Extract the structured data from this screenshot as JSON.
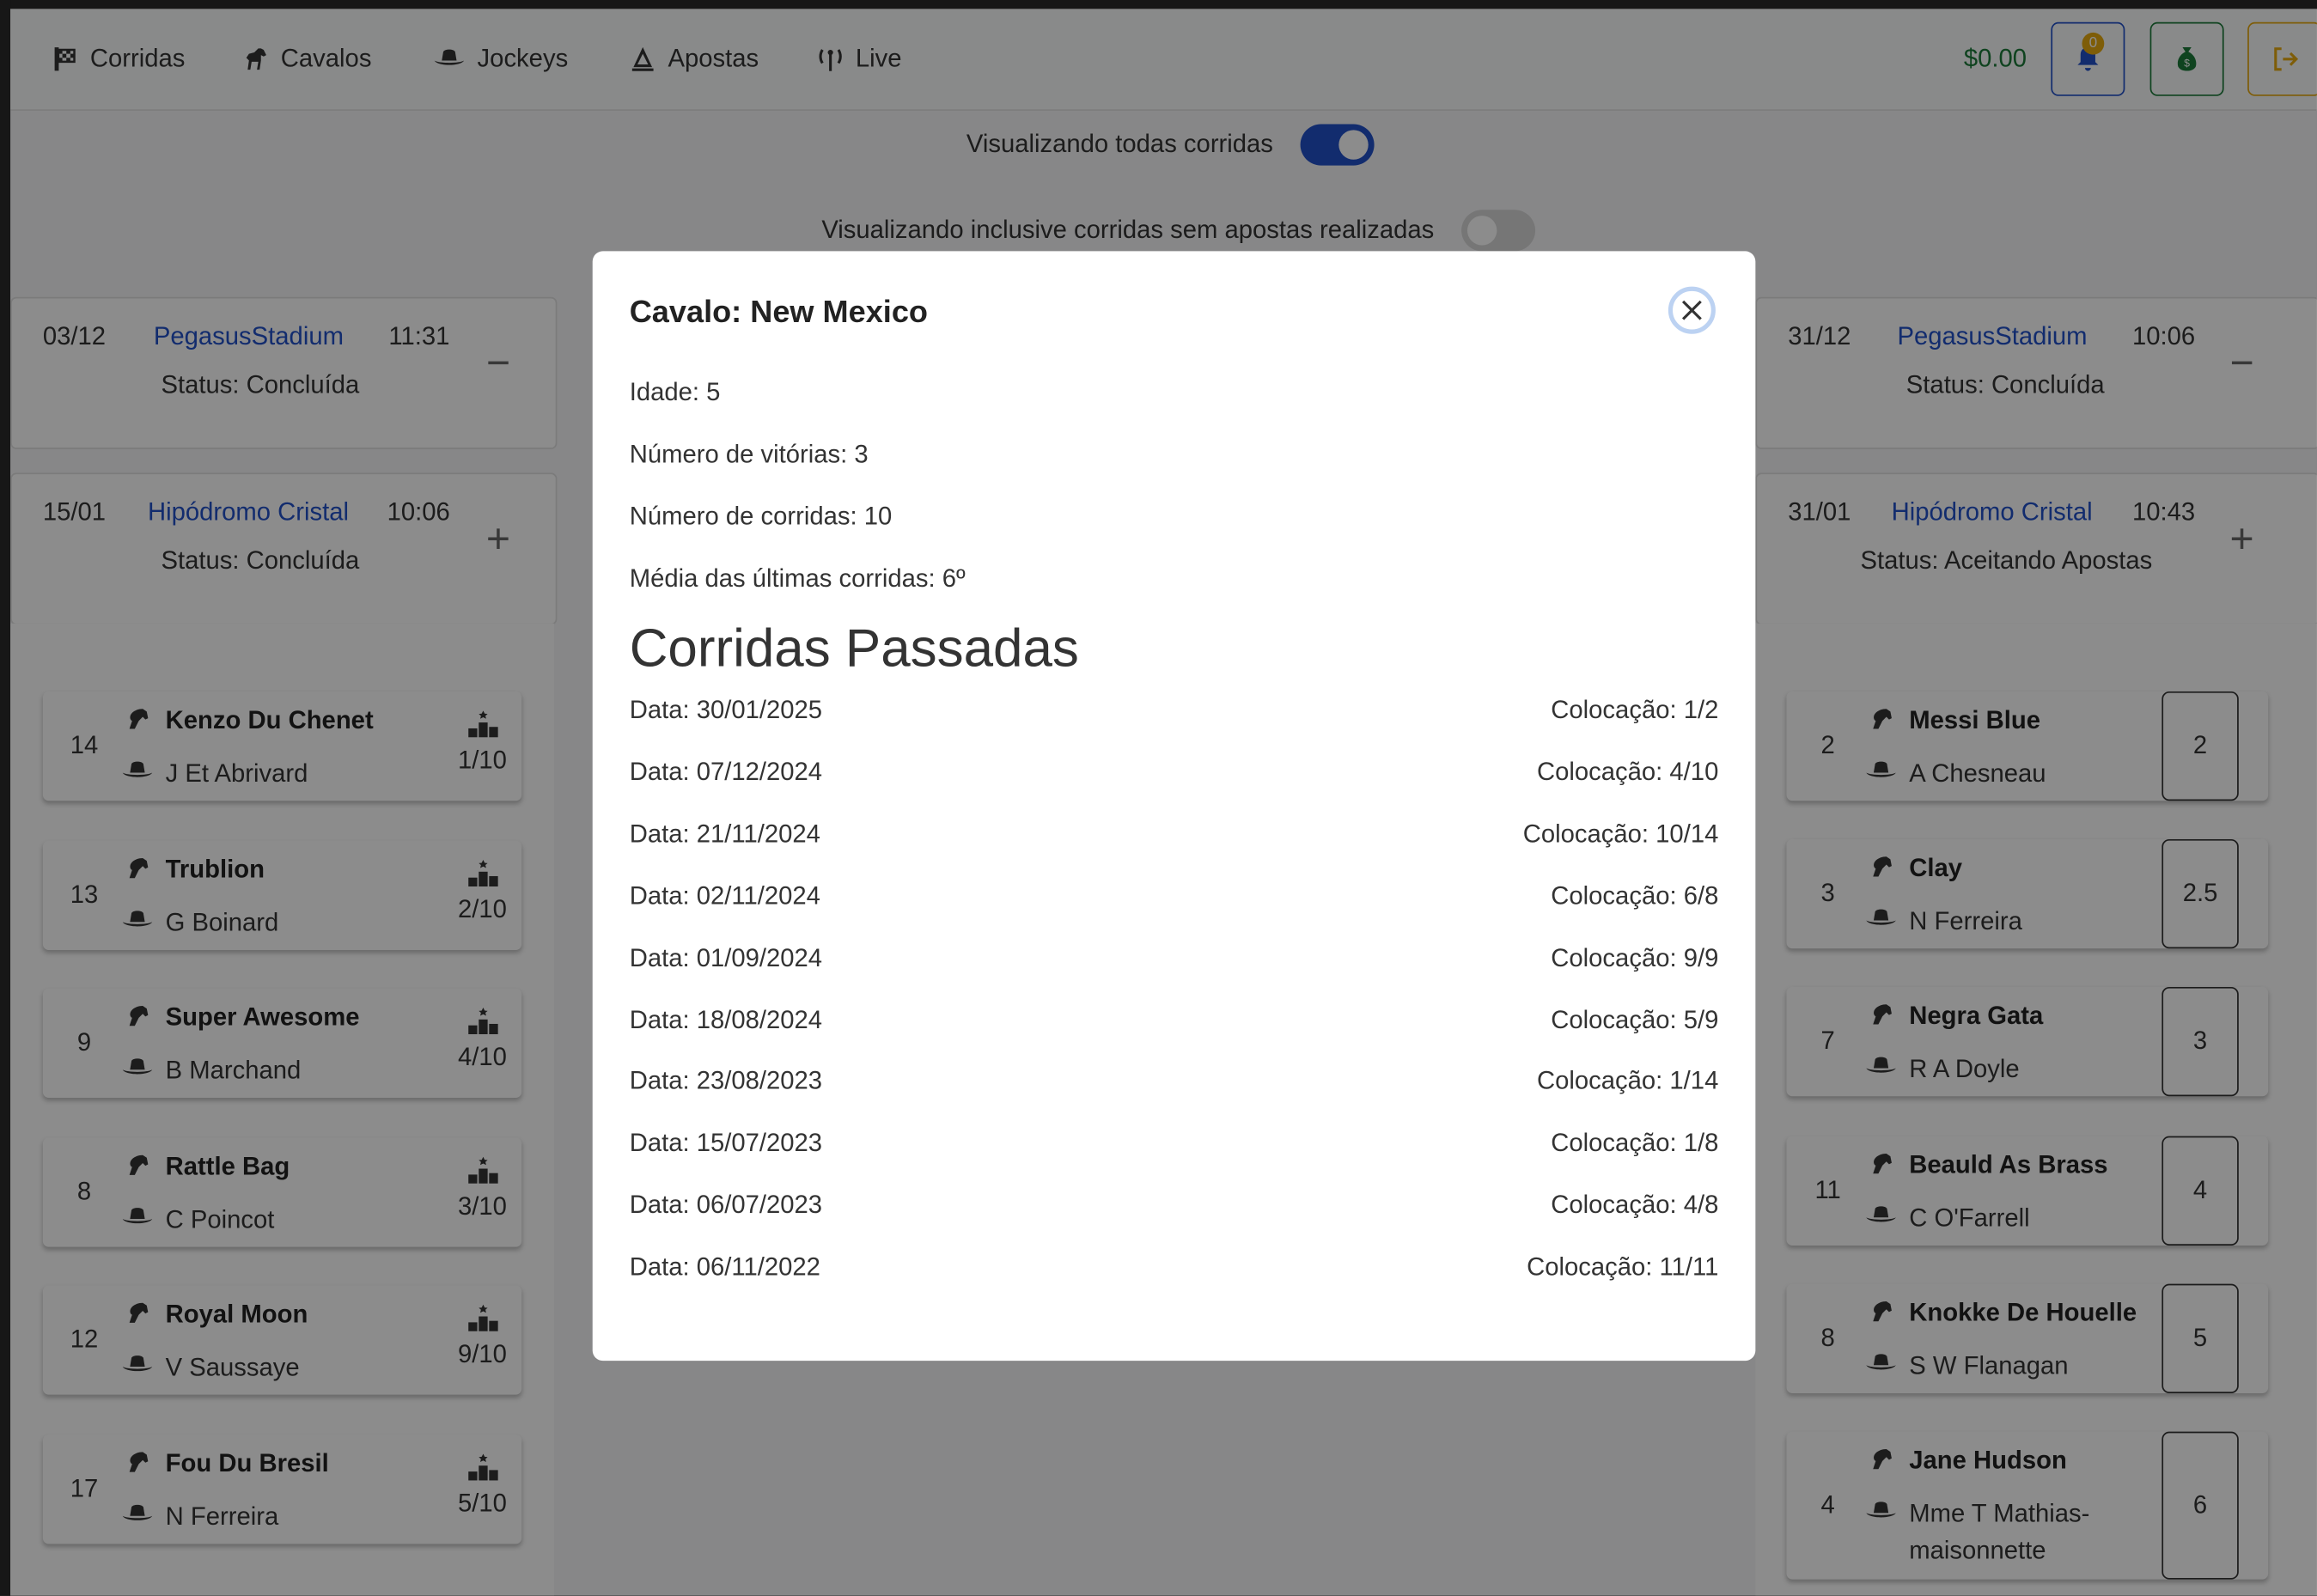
{
  "nav": {
    "items": [
      {
        "label": "Corridas",
        "icon": "checkered-flag-icon"
      },
      {
        "label": "Cavalos",
        "icon": "horse-icon"
      },
      {
        "label": "Jockeys",
        "icon": "hat-cowboy-icon"
      },
      {
        "label": "Apostas",
        "icon": "ticket-icon"
      },
      {
        "label": "Live",
        "icon": "broadcast-tower-icon"
      }
    ],
    "balance": "$0.00",
    "notifications_count": "0",
    "colors": {
      "bell": "#2250c8",
      "money": "#1d7a3a",
      "logout": "#e5a90f"
    }
  },
  "filters": {
    "all_races_label": "Visualizando todas corridas",
    "all_races_on": true,
    "no_bets_label": "Visualizando inclusive corridas sem apostas realizadas",
    "no_bets_on": false
  },
  "races": {
    "left": [
      {
        "date": "03/12",
        "venue": "PegasusStadium",
        "time": "11:31",
        "status": "Status: Concluída",
        "toggle": "−"
      },
      {
        "date": "15/01",
        "venue": "Hipódromo Cristal",
        "time": "10:06",
        "status": "Status: Concluída",
        "toggle": "+"
      }
    ],
    "right": [
      {
        "date": "31/12",
        "venue": "PegasusStadium",
        "time": "10:06",
        "status": "Status: Concluída",
        "toggle": "−"
      },
      {
        "date": "31/01",
        "venue": "Hipódromo Cristal",
        "time": "10:43",
        "status": "Status: Aceitando Apostas",
        "toggle": "+"
      }
    ]
  },
  "left_horses": [
    {
      "number": "14",
      "horse": "Kenzo Du Chenet",
      "jockey": "J Et Abrivard",
      "position": "1/10"
    },
    {
      "number": "13",
      "horse": "Trublion",
      "jockey": "G Boinard",
      "position": "2/10"
    },
    {
      "number": "9",
      "horse": "Super Awesome",
      "jockey": "B Marchand",
      "position": "4/10"
    },
    {
      "number": "8",
      "horse": "Rattle Bag",
      "jockey": "C Poincot",
      "position": "3/10"
    },
    {
      "number": "12",
      "horse": "Royal Moon",
      "jockey": "V Saussaye",
      "position": "9/10"
    },
    {
      "number": "17",
      "horse": "Fou Du Bresil",
      "jockey": "N Ferreira",
      "position": "5/10"
    }
  ],
  "right_horses": [
    {
      "number": "2",
      "horse": "Messi Blue",
      "jockey": "A Chesneau",
      "odds": "2"
    },
    {
      "number": "3",
      "horse": "Clay",
      "jockey": "N Ferreira",
      "odds": "2.5"
    },
    {
      "number": "7",
      "horse": "Negra Gata",
      "jockey": "R A Doyle",
      "odds": "3"
    },
    {
      "number": "11",
      "horse": "Beauld As Brass",
      "jockey": "C O'Farrell",
      "odds": "4"
    },
    {
      "number": "8",
      "horse": "Knokke De Houelle",
      "jockey": "S W Flanagan",
      "odds": "5"
    },
    {
      "number": "4",
      "horse": "Jane Hudson",
      "jockey": "Mme T Mathias-maisonnette",
      "odds": "6"
    }
  ],
  "modal": {
    "title": "Cavalo: New Mexico",
    "age": "Idade: 5",
    "wins": "Número de vitórias: 3",
    "races": "Número de corridas: 10",
    "avg": "Média das últimas corridas: 6º",
    "section_title": "Corridas Passadas",
    "past_races": [
      {
        "date": "Data: 30/01/2025",
        "place": "Colocação: 1/2"
      },
      {
        "date": "Data: 07/12/2024",
        "place": "Colocação: 4/10"
      },
      {
        "date": "Data: 21/11/2024",
        "place": "Colocação: 10/14"
      },
      {
        "date": "Data: 02/11/2024",
        "place": "Colocação: 6/8"
      },
      {
        "date": "Data: 01/09/2024",
        "place": "Colocação: 9/9"
      },
      {
        "date": "Data: 18/08/2024",
        "place": "Colocação: 5/9"
      },
      {
        "date": "Data: 23/08/2023",
        "place": "Colocação: 1/14"
      },
      {
        "date": "Data: 15/07/2023",
        "place": "Colocação: 1/8"
      },
      {
        "date": "Data: 06/07/2023",
        "place": "Colocação: 4/8"
      },
      {
        "date": "Data: 06/11/2022",
        "place": "Colocação: 11/11"
      }
    ]
  }
}
